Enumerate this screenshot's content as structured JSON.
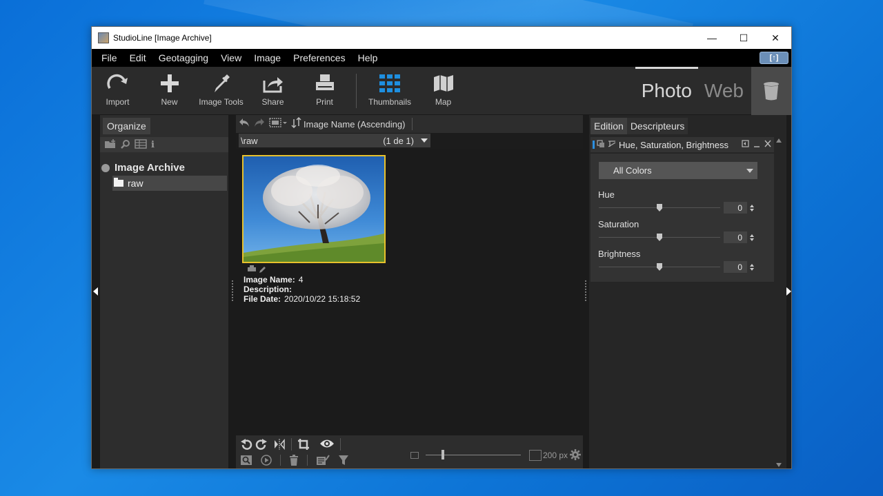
{
  "window": {
    "title": "StudioLine [Image Archive]",
    "controls": {
      "minimize": "—",
      "maximize": "☐",
      "close": "✕"
    }
  },
  "menu": {
    "items": [
      "File",
      "Edit",
      "Geotagging",
      "View",
      "Image",
      "Preferences",
      "Help"
    ],
    "update_button": "[↑]"
  },
  "toolbar": {
    "tools": [
      {
        "label": "Import",
        "icon": "import-icon"
      },
      {
        "label": "New",
        "icon": "plus-icon"
      },
      {
        "label": "Image Tools",
        "icon": "pipette-icon"
      },
      {
        "label": "Share",
        "icon": "share-icon"
      },
      {
        "label": "Print",
        "icon": "printer-icon"
      },
      {
        "label": "Thumbnails",
        "icon": "grid-icon"
      },
      {
        "label": "Map",
        "icon": "map-icon"
      }
    ],
    "modes": {
      "photo": "Photo",
      "web": "Web",
      "active": "Photo"
    },
    "trash_icon": "trash-icon"
  },
  "left_panel": {
    "tab": "Organize",
    "icons": [
      "new-folder-icon",
      "search-icon",
      "table-icon",
      "info-icon"
    ],
    "tree_root": "Image Archive",
    "tree_children": [
      {
        "label": "raw",
        "selected": true
      }
    ]
  },
  "center_panel": {
    "sort_label": "Image Name (Ascending)",
    "path": "\\raw",
    "page_count": "(1 de 1)",
    "thumbnails": [
      {
        "image_name_label": "Image Name:",
        "image_name": "4",
        "description_label": "Description:",
        "description": "",
        "file_date_label": "File Date:",
        "file_date": "2020/10/22 15:18:52",
        "selected": true
      }
    ],
    "bottom": {
      "thumbnail_size": "200 px",
      "size_slider_fraction": 0.17
    }
  },
  "right_panel": {
    "tabs": [
      "Edition",
      "Descripteurs"
    ],
    "active_tab": "Edition",
    "section_title": "Hue, Saturation, Brightness",
    "color_select": "All Colors",
    "adjustments": [
      {
        "label": "Hue",
        "value": "0",
        "slider_fraction": 0.5
      },
      {
        "label": "Saturation",
        "value": "0",
        "slider_fraction": 0.5
      },
      {
        "label": "Brightness",
        "value": "0",
        "slider_fraction": 0.5
      }
    ]
  }
}
